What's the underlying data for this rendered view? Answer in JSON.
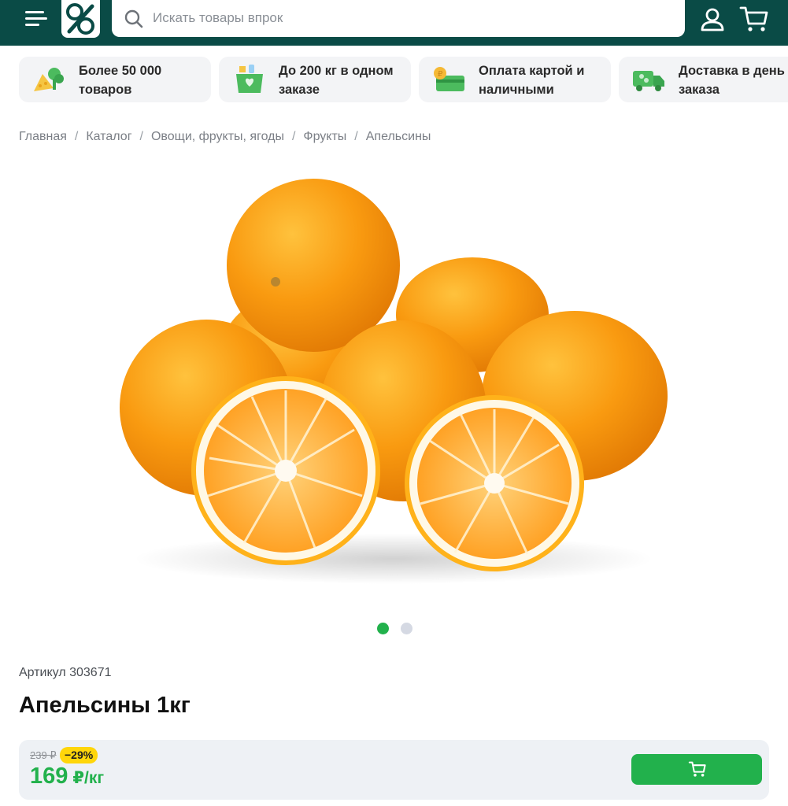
{
  "header": {
    "search_placeholder": "Искать товары впрок",
    "colors": {
      "background": "#0a4b46",
      "accent": "#22b14c"
    }
  },
  "features": [
    {
      "icon": "vegetables-icon",
      "line1": "Более 50 000",
      "line2": "товаров"
    },
    {
      "icon": "basket-icon",
      "line1": "До 200 кг в одном",
      "line2": "заказе"
    },
    {
      "icon": "payment-card-icon",
      "line1": "Оплата картой и",
      "line2": "наличными"
    },
    {
      "icon": "delivery-truck-icon",
      "line1": "Доставка в день",
      "line2": "заказа"
    }
  ],
  "breadcrumb": [
    "Главная",
    "Каталог",
    "Овощи, фрукты, ягоды",
    "Фрукты",
    "Апельсины"
  ],
  "gallery": {
    "slides": 2,
    "active_slide": 1
  },
  "product": {
    "article": "Артикул 303671",
    "title": "Апельсины 1кг",
    "old_price": "239 ₽",
    "discount": "−29%",
    "price": "169",
    "unit": "₽/кг"
  }
}
